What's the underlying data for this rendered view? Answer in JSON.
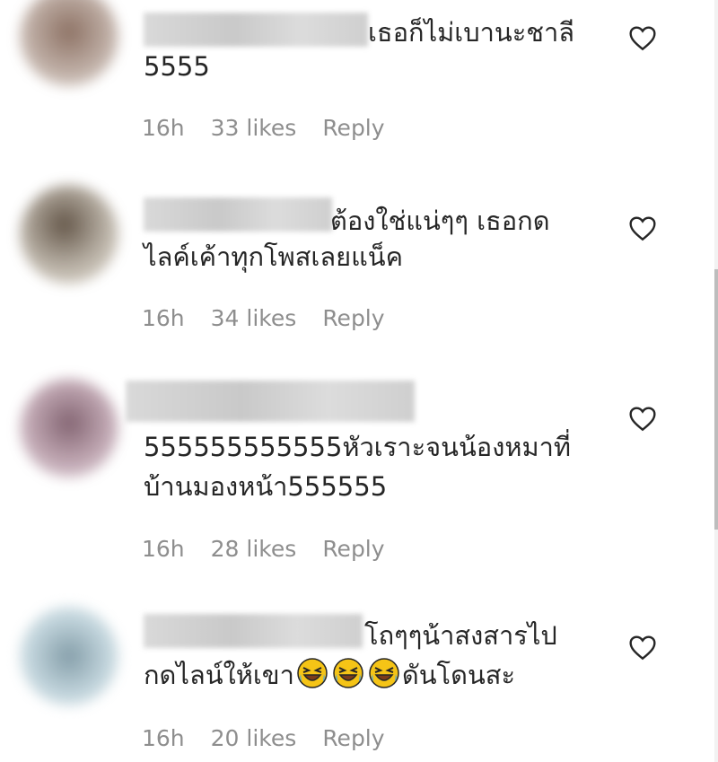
{
  "comments": [
    {
      "line1": "เธอก็ไม่เบานะชาลี",
      "line2": "5555",
      "time": "16h",
      "likes": "33 likes",
      "reply": "Reply"
    },
    {
      "line1": "ต้องใช่แน่ๆๆ เธอกด",
      "line2": "ไลค์เค้าทุกโพสเลยแน็ค",
      "time": "16h",
      "likes": "34 likes",
      "reply": "Reply"
    },
    {
      "line1": "555555555555หัวเราะจนน้องหมาที่",
      "line2": "บ้านมองหน้า555555",
      "time": "16h",
      "likes": "28 likes",
      "reply": "Reply"
    },
    {
      "line1": "โถๆๆน้าสงสารไป",
      "line2_pre": "กดไลน์ให้เขา",
      "line2_post": "ดันโดนสะ",
      "time": "16h",
      "likes": "20 likes",
      "reply": "Reply"
    }
  ],
  "icons": {
    "heart": "heart-outline-icon",
    "emoji": "rolling-on-floor-laughing-emoji"
  },
  "colors": {
    "text": "#262626",
    "meta": "#8e8e8e"
  }
}
